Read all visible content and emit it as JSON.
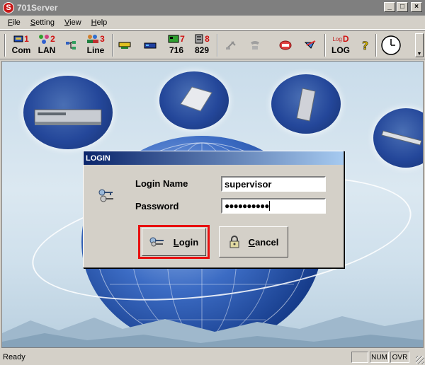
{
  "window": {
    "title": "701Server",
    "app_icon_letter": "S",
    "controls": {
      "minimize": "_",
      "maximize": "□",
      "close": "×"
    }
  },
  "menu": {
    "items": [
      {
        "label": "File",
        "mnemonic": "F",
        "rest": "ile"
      },
      {
        "label": "Setting",
        "mnemonic": "S",
        "rest": "etting"
      },
      {
        "label": "View",
        "mnemonic": "V",
        "rest": "iew"
      },
      {
        "label": "Help",
        "mnemonic": "H",
        "rest": "elp"
      }
    ]
  },
  "toolbar": {
    "com": {
      "num": "1",
      "label": "Com",
      "icon": "com-port-icon"
    },
    "lan": {
      "num": "2",
      "label": "LAN",
      "icon": "lan-network-icon"
    },
    "net": {
      "icon": "network-tree-icon"
    },
    "line": {
      "num": "3",
      "label": "Line",
      "icon": "line-users-icon"
    },
    "dev1": {
      "icon": "server-device-icon"
    },
    "dev2": {
      "icon": "modem-device-icon"
    },
    "d716": {
      "num": "7",
      "label": "716",
      "icon": "board-716-icon"
    },
    "d829": {
      "num": "8",
      "label": "829",
      "icon": "board-829-icon"
    },
    "t1": {
      "icon": "disabled-tool-icon"
    },
    "t2": {
      "icon": "disabled-phone-icon"
    },
    "t3": {
      "icon": "record-icon"
    },
    "t4": {
      "icon": "pen-tool-icon"
    },
    "log": {
      "num": "D",
      "label": "LOG",
      "prefix": "Log",
      "icon": "log-icon"
    },
    "help": {
      "icon": "help-question-icon"
    },
    "clock": {
      "icon": "clock-icon"
    }
  },
  "dialog": {
    "title": "LOGIN",
    "login_name_label": "Login Name",
    "login_name_value": "supervisor",
    "password_label": "Password",
    "password_value": "●●●●●●●●●●",
    "login_button": {
      "mnemonic": "L",
      "rest": "ogin"
    },
    "cancel_button": {
      "mnemonic": "C",
      "rest": "ancel"
    }
  },
  "status": {
    "text": "Ready",
    "num": "NUM",
    "ovr": "OVR"
  },
  "colors": {
    "title_inactive": "#7f7f7f",
    "dialog_title_start": "#0a246a",
    "dialog_title_end": "#a6caf0",
    "highlight": "#e81010",
    "toolbar_number": "#d01010"
  }
}
